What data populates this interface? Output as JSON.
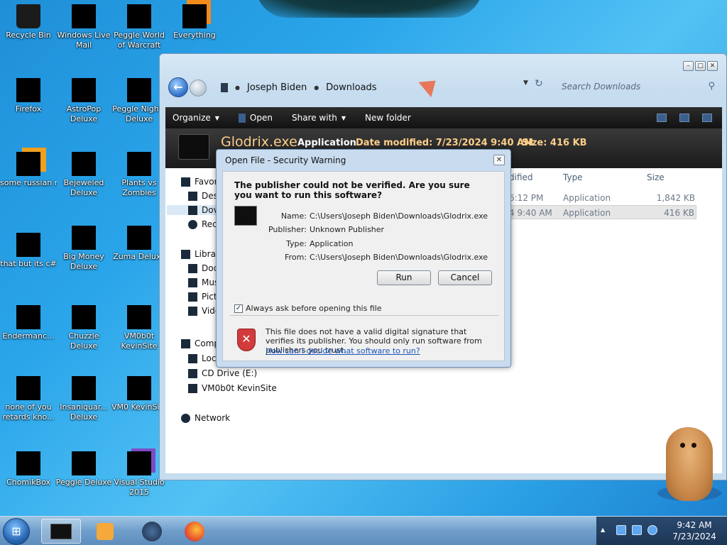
{
  "desktop": {
    "icons": [
      {
        "label": "Recycle Bin",
        "icon": "recycle-bin-icon"
      },
      {
        "label": "Windows Live Mail",
        "icon": "mail-icon"
      },
      {
        "label": "Peggle World of Warcraft",
        "icon": "peggle-icon"
      },
      {
        "label": "Everything",
        "icon": "search-app-icon"
      },
      {
        "label": "Firefox",
        "icon": "firefox-icon"
      },
      {
        "label": "AstroPop Deluxe",
        "icon": "game-icon"
      },
      {
        "label": "Peggle Nights Deluxe",
        "icon": "peggle-icon"
      },
      {
        "label": "some russian ran a rat",
        "icon": "app-icon"
      },
      {
        "label": "Bejeweled Deluxe",
        "icon": "game-icon"
      },
      {
        "label": "Plants vs Zombies",
        "icon": "game-icon"
      },
      {
        "label": "that but its c#",
        "icon": "app-icon"
      },
      {
        "label": "Big Money Deluxe",
        "icon": "game-icon"
      },
      {
        "label": "Zuma Deluxe",
        "icon": "game-icon"
      },
      {
        "label": "Endermanc...",
        "icon": "app-icon"
      },
      {
        "label": "Chuzzle Deluxe",
        "icon": "game-icon"
      },
      {
        "label": "VM0b0t KevinSite",
        "icon": "app-icon"
      },
      {
        "label": "none of you retards kno...",
        "icon": "app-icon"
      },
      {
        "label": "Insaniquar... Deluxe",
        "icon": "game-icon"
      },
      {
        "label": "VM0 KevinSi...",
        "icon": "app-icon"
      },
      {
        "label": "ChomikBox",
        "icon": "app-icon"
      },
      {
        "label": "Peggle Deluxe",
        "icon": "peggle-icon"
      },
      {
        "label": "Visual Studio 2015",
        "icon": "visual-studio-icon"
      }
    ]
  },
  "explorer": {
    "breadcrumb": [
      "Joseph Biden",
      "Downloads"
    ],
    "search_placeholder": "Search Downloads",
    "toolbar": {
      "organize": "Organize",
      "open": "Open",
      "share_with": "Share with",
      "new_folder": "New folder"
    },
    "details": {
      "file_name": "Glodrix.exe",
      "file_type": "Application",
      "date_modified": "Date modified: 7/23/2024 9:40 AM",
      "size": "Size: 416 KB"
    },
    "nav_pane": {
      "favorites": "Favor",
      "desktop": "Des",
      "downloads": "Dov",
      "recent": "Rec",
      "libraries": "Librar",
      "documents": "Doc",
      "music": "Mus",
      "pictures": "Pict",
      "videos": "Vide",
      "computer": "Comp",
      "local_disk": "Loc",
      "cd_drive": "CD Drive (E:)",
      "vm_share": "VM0b0t KevinSite",
      "network": "Network"
    },
    "columns": {
      "date": "dified",
      "type": "Type",
      "size": "Size"
    },
    "files": [
      {
        "date": "6:12 PM",
        "type": "Application",
        "size": "1,842 KB"
      },
      {
        "date": "4 9:40 AM",
        "type": "Application",
        "size": "416 KB"
      }
    ]
  },
  "dialog": {
    "title": "Open File - Security Warning",
    "heading": "The publisher could not be verified.  Are you sure you want to run this software?",
    "name_label": "Name:",
    "name_value": "C:\\Users\\Joseph Biden\\Downloads\\Glodrix.exe",
    "publisher_label": "Publisher:",
    "publisher_value": "Unknown Publisher",
    "type_label": "Type:",
    "type_value": "Application",
    "from_label": "From:",
    "from_value": "C:\\Users\\Joseph Biden\\Downloads\\Glodrix.exe",
    "run_button": "Run",
    "cancel_button": "Cancel",
    "checkbox_label": "Always ask before opening this file",
    "checkbox_checked": true,
    "warning_text": "This file does not have a valid digital signature that verifies its publisher.  You should only run software from publishers you trust.",
    "help_link": "How can I decide what software to run?"
  },
  "taskbar": {
    "clock_time": "9:42 AM",
    "clock_date": "7/23/2024"
  },
  "colors": {
    "accent": "#2a9fe4",
    "toolbar_dark": "#1a1a1a",
    "details_highlight": "#ffcf8a",
    "link": "#1c56b8"
  }
}
